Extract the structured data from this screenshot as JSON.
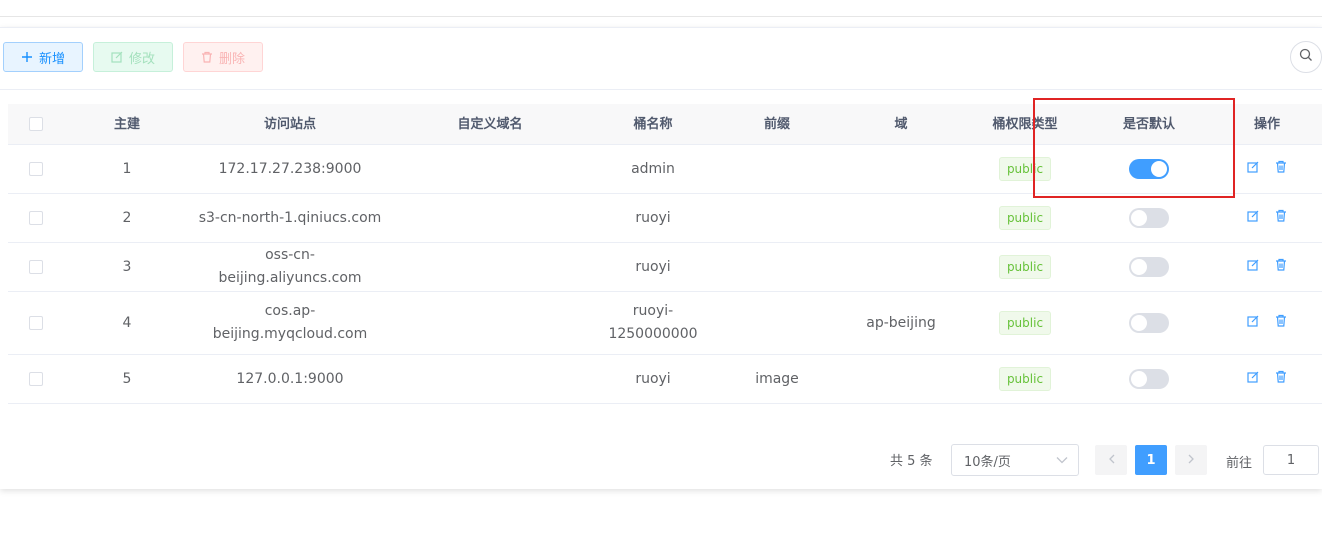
{
  "toolbar": {
    "add_label": "新增",
    "edit_label": "修改",
    "delete_label": "删除"
  },
  "table": {
    "headers": {
      "id": "主建",
      "site": "访问站点",
      "custom_domain": "自定义域名",
      "bucket": "桶名称",
      "prefix": "前缀",
      "region": "域",
      "permission": "桶权限类型",
      "is_default": "是否默认",
      "actions": "操作"
    },
    "rows": [
      {
        "id": "1",
        "site": "172.17.27.238:9000",
        "custom_domain": "",
        "bucket": "admin",
        "prefix": "",
        "region": "",
        "permission": "public",
        "is_default": true
      },
      {
        "id": "2",
        "site": "s3-cn-north-1.qiniucs.com",
        "custom_domain": "",
        "bucket": "ruoyi",
        "prefix": "",
        "region": "",
        "permission": "public",
        "is_default": false
      },
      {
        "id": "3",
        "site": "oss-cn-beijing.aliyuncs.com",
        "custom_domain": "",
        "bucket": "ruoyi",
        "prefix": "",
        "region": "",
        "permission": "public",
        "is_default": false
      },
      {
        "id": "4",
        "site_line1": "cos.ap-",
        "site_line2": "beijing.myqcloud.com",
        "custom_domain": "",
        "bucket_line1": "ruoyi-",
        "bucket_line2": "1250000000",
        "prefix": "",
        "region": "ap-beijing",
        "permission": "public",
        "is_default": false
      },
      {
        "id": "5",
        "site": "127.0.0.1:9000",
        "custom_domain": "",
        "bucket": "ruoyi",
        "prefix": "image",
        "region": "",
        "permission": "public",
        "is_default": false
      }
    ]
  },
  "pagination": {
    "total_text": "共 5 条",
    "page_size": "10条/页",
    "current_page": "1",
    "goto_label": "前往",
    "goto_value": "1"
  },
  "colors": {
    "primary": "#409eff",
    "tag_green": "#67c23a",
    "highlight_red": "#e02424"
  }
}
